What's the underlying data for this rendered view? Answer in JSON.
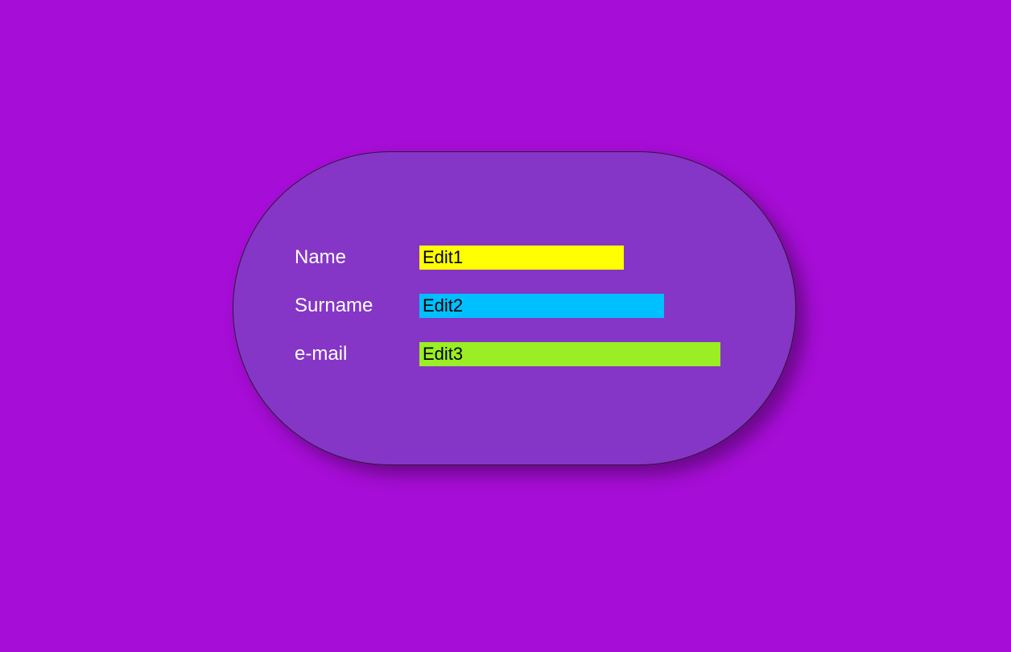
{
  "colors": {
    "page_bg": "#a60dd6",
    "panel_bg": "#8636c6",
    "panel_border": "#2a1a3a",
    "label_text": "#ffffff",
    "edit_text": "#000000",
    "edit_bg": [
      "#ffff00",
      "#00bfff",
      "#9aee23"
    ]
  },
  "form": {
    "rows": [
      {
        "label": "Name",
        "value": "Edit1"
      },
      {
        "label": "Surname",
        "value": "Edit2"
      },
      {
        "label": "e-mail",
        "value": "Edit3"
      }
    ]
  }
}
